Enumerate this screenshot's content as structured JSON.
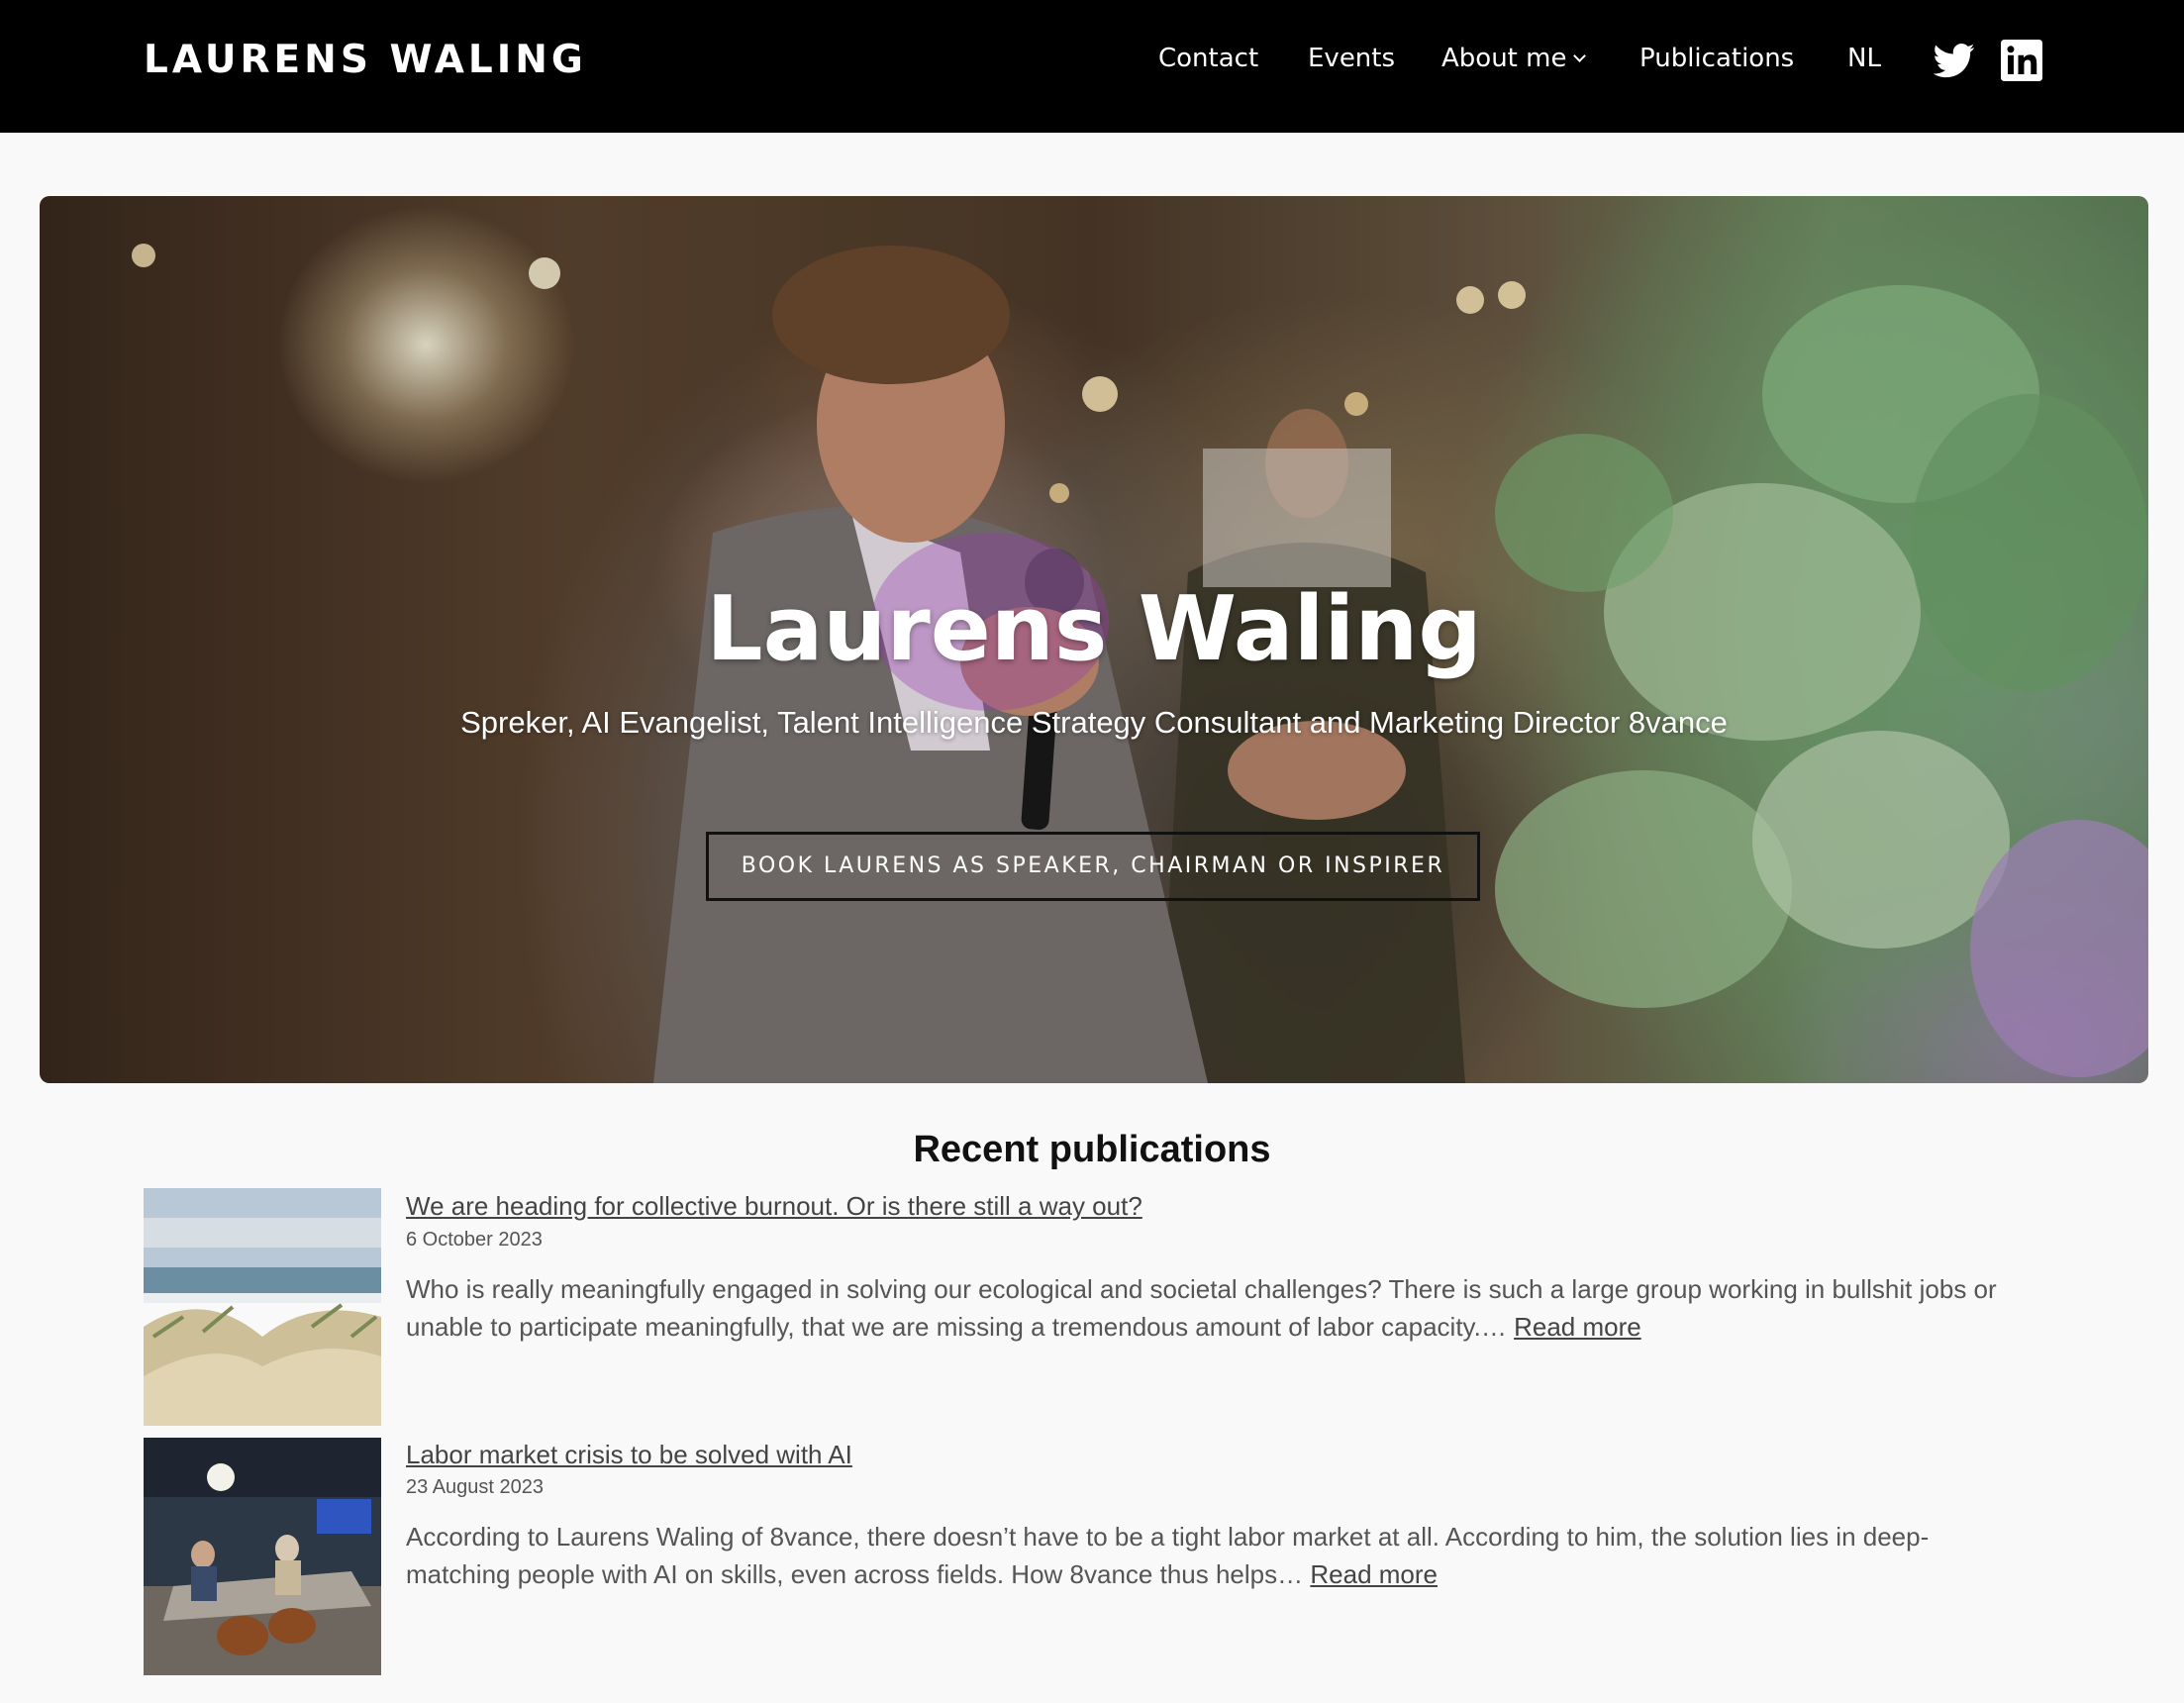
{
  "header": {
    "brand": "LAURENS WALING",
    "nav": [
      {
        "label": "Contact"
      },
      {
        "label": "Events"
      },
      {
        "label": "About me",
        "has_dropdown": true
      },
      {
        "label": "Publications"
      },
      {
        "label": "NL"
      }
    ],
    "social": [
      {
        "icon": "twitter-icon"
      },
      {
        "icon": "linkedin-icon"
      }
    ]
  },
  "hero": {
    "title": "Laurens Waling",
    "subtitle": "Spreker, AI Evangelist, Talent Intelligence Strategy Consultant and Marketing Director 8vance",
    "cta_label": "BOOK LAURENS AS SPEAKER, CHAIRMAN OR INSPIRER"
  },
  "recent": {
    "heading": "Recent publications",
    "items": [
      {
        "title": "We are heading for collective burnout. Or is there still a way out?",
        "date": "6 October 2023",
        "excerpt": "Who is really meaningfully engaged in solving our ecological and societal challenges? There is such a large group working in bullshit jobs or unable to participate meaningfully, that we are missing a tremendous amount of labor capacity.…",
        "read_more": "Read more"
      },
      {
        "title": "Labor market crisis to be solved with AI",
        "date": "23 August 2023",
        "excerpt": "According to Laurens Waling of 8vance, there doesn’t have to be a tight labor market at all. According to him, the solution lies in deep-matching people with AI on skills, even across fields. How 8vance thus helps…",
        "read_more": "Read more"
      }
    ]
  },
  "colors": {
    "header_bg": "#000000",
    "page_bg": "#f9f9f9",
    "text_muted": "#555555"
  }
}
